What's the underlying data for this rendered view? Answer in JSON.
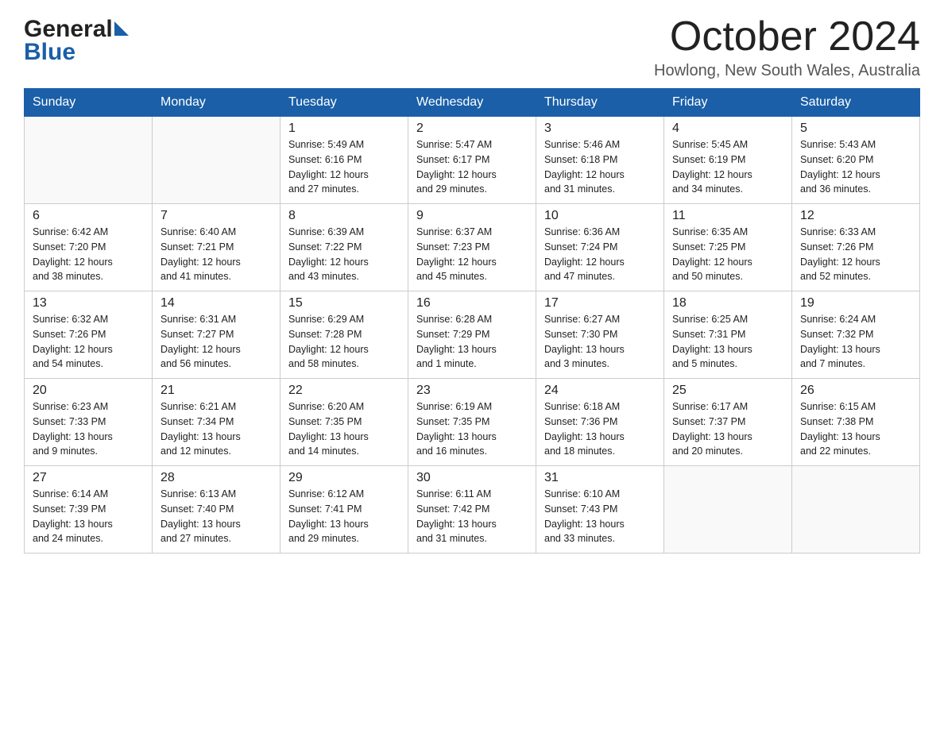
{
  "header": {
    "month_title": "October 2024",
    "location": "Howlong, New South Wales, Australia",
    "logo_general": "General",
    "logo_blue": "Blue"
  },
  "columns": [
    "Sunday",
    "Monday",
    "Tuesday",
    "Wednesday",
    "Thursday",
    "Friday",
    "Saturday"
  ],
  "weeks": [
    [
      {
        "day": "",
        "info": ""
      },
      {
        "day": "",
        "info": ""
      },
      {
        "day": "1",
        "info": "Sunrise: 5:49 AM\nSunset: 6:16 PM\nDaylight: 12 hours\nand 27 minutes."
      },
      {
        "day": "2",
        "info": "Sunrise: 5:47 AM\nSunset: 6:17 PM\nDaylight: 12 hours\nand 29 minutes."
      },
      {
        "day": "3",
        "info": "Sunrise: 5:46 AM\nSunset: 6:18 PM\nDaylight: 12 hours\nand 31 minutes."
      },
      {
        "day": "4",
        "info": "Sunrise: 5:45 AM\nSunset: 6:19 PM\nDaylight: 12 hours\nand 34 minutes."
      },
      {
        "day": "5",
        "info": "Sunrise: 5:43 AM\nSunset: 6:20 PM\nDaylight: 12 hours\nand 36 minutes."
      }
    ],
    [
      {
        "day": "6",
        "info": "Sunrise: 6:42 AM\nSunset: 7:20 PM\nDaylight: 12 hours\nand 38 minutes."
      },
      {
        "day": "7",
        "info": "Sunrise: 6:40 AM\nSunset: 7:21 PM\nDaylight: 12 hours\nand 41 minutes."
      },
      {
        "day": "8",
        "info": "Sunrise: 6:39 AM\nSunset: 7:22 PM\nDaylight: 12 hours\nand 43 minutes."
      },
      {
        "day": "9",
        "info": "Sunrise: 6:37 AM\nSunset: 7:23 PM\nDaylight: 12 hours\nand 45 minutes."
      },
      {
        "day": "10",
        "info": "Sunrise: 6:36 AM\nSunset: 7:24 PM\nDaylight: 12 hours\nand 47 minutes."
      },
      {
        "day": "11",
        "info": "Sunrise: 6:35 AM\nSunset: 7:25 PM\nDaylight: 12 hours\nand 50 minutes."
      },
      {
        "day": "12",
        "info": "Sunrise: 6:33 AM\nSunset: 7:26 PM\nDaylight: 12 hours\nand 52 minutes."
      }
    ],
    [
      {
        "day": "13",
        "info": "Sunrise: 6:32 AM\nSunset: 7:26 PM\nDaylight: 12 hours\nand 54 minutes."
      },
      {
        "day": "14",
        "info": "Sunrise: 6:31 AM\nSunset: 7:27 PM\nDaylight: 12 hours\nand 56 minutes."
      },
      {
        "day": "15",
        "info": "Sunrise: 6:29 AM\nSunset: 7:28 PM\nDaylight: 12 hours\nand 58 minutes."
      },
      {
        "day": "16",
        "info": "Sunrise: 6:28 AM\nSunset: 7:29 PM\nDaylight: 13 hours\nand 1 minute."
      },
      {
        "day": "17",
        "info": "Sunrise: 6:27 AM\nSunset: 7:30 PM\nDaylight: 13 hours\nand 3 minutes."
      },
      {
        "day": "18",
        "info": "Sunrise: 6:25 AM\nSunset: 7:31 PM\nDaylight: 13 hours\nand 5 minutes."
      },
      {
        "day": "19",
        "info": "Sunrise: 6:24 AM\nSunset: 7:32 PM\nDaylight: 13 hours\nand 7 minutes."
      }
    ],
    [
      {
        "day": "20",
        "info": "Sunrise: 6:23 AM\nSunset: 7:33 PM\nDaylight: 13 hours\nand 9 minutes."
      },
      {
        "day": "21",
        "info": "Sunrise: 6:21 AM\nSunset: 7:34 PM\nDaylight: 13 hours\nand 12 minutes."
      },
      {
        "day": "22",
        "info": "Sunrise: 6:20 AM\nSunset: 7:35 PM\nDaylight: 13 hours\nand 14 minutes."
      },
      {
        "day": "23",
        "info": "Sunrise: 6:19 AM\nSunset: 7:35 PM\nDaylight: 13 hours\nand 16 minutes."
      },
      {
        "day": "24",
        "info": "Sunrise: 6:18 AM\nSunset: 7:36 PM\nDaylight: 13 hours\nand 18 minutes."
      },
      {
        "day": "25",
        "info": "Sunrise: 6:17 AM\nSunset: 7:37 PM\nDaylight: 13 hours\nand 20 minutes."
      },
      {
        "day": "26",
        "info": "Sunrise: 6:15 AM\nSunset: 7:38 PM\nDaylight: 13 hours\nand 22 minutes."
      }
    ],
    [
      {
        "day": "27",
        "info": "Sunrise: 6:14 AM\nSunset: 7:39 PM\nDaylight: 13 hours\nand 24 minutes."
      },
      {
        "day": "28",
        "info": "Sunrise: 6:13 AM\nSunset: 7:40 PM\nDaylight: 13 hours\nand 27 minutes."
      },
      {
        "day": "29",
        "info": "Sunrise: 6:12 AM\nSunset: 7:41 PM\nDaylight: 13 hours\nand 29 minutes."
      },
      {
        "day": "30",
        "info": "Sunrise: 6:11 AM\nSunset: 7:42 PM\nDaylight: 13 hours\nand 31 minutes."
      },
      {
        "day": "31",
        "info": "Sunrise: 6:10 AM\nSunset: 7:43 PM\nDaylight: 13 hours\nand 33 minutes."
      },
      {
        "day": "",
        "info": ""
      },
      {
        "day": "",
        "info": ""
      }
    ]
  ]
}
